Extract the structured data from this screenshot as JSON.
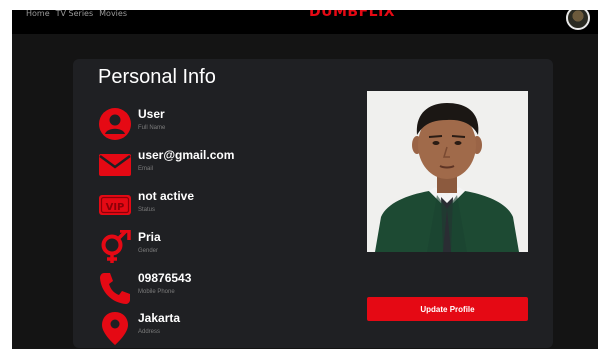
{
  "nav": {
    "items": [
      "Home",
      "TV Series",
      "Movies"
    ]
  },
  "brand": "DUMBFLIX",
  "profile": {
    "title": "Personal Info",
    "fields": [
      {
        "value": "User",
        "label": "Full Name",
        "icon": "user-icon"
      },
      {
        "value": "user@gmail.com",
        "label": "Email",
        "icon": "mail-icon"
      },
      {
        "value": "not active",
        "label": "Status",
        "icon": "vip-icon"
      },
      {
        "value": "Pria",
        "label": "Gender",
        "icon": "gender-icon"
      },
      {
        "value": "09876543",
        "label": "Mobile Phone",
        "icon": "phone-icon"
      },
      {
        "value": "Jakarta",
        "label": "Address",
        "icon": "location-pin-icon"
      }
    ],
    "update_button_label": "Update Profile"
  },
  "colors": {
    "accent": "#e50914",
    "background": "#141414",
    "card": "#1f2023",
    "topbar": "#000000"
  }
}
